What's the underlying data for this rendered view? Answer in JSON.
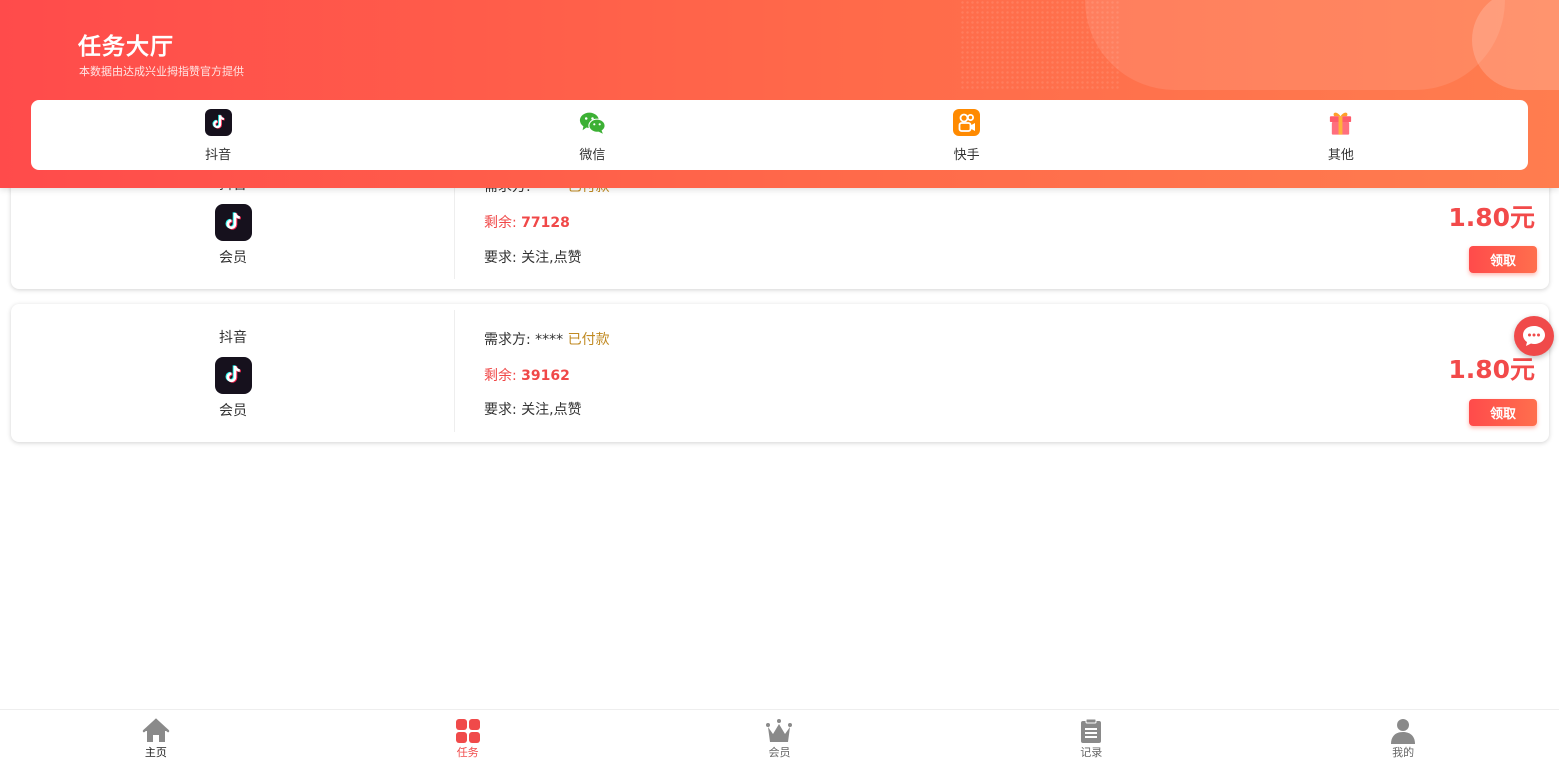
{
  "header": {
    "title": "任务大厅",
    "subtitle": "本数据由达成兴业拇指赞官方提供"
  },
  "categories": [
    {
      "label": "抖音",
      "icon": "douyin-icon"
    },
    {
      "label": "微信",
      "icon": "wechat-icon"
    },
    {
      "label": "快手",
      "icon": "kuaishou-icon"
    },
    {
      "label": "其他",
      "icon": "gift-icon"
    }
  ],
  "tasks": [
    {
      "platform": "抖音",
      "member": "会员",
      "demander_label": "需求方:",
      "demander": "****",
      "status": "已付款",
      "remain_label": "剩余:",
      "remain": "77128",
      "require_label": "要求:",
      "require": "关注,点赞",
      "price": "1.80元",
      "claim_label": "领取"
    },
    {
      "platform": "抖音",
      "member": "会员",
      "demander_label": "需求方:",
      "demander": "****",
      "status": "已付款",
      "remain_label": "剩余:",
      "remain": "39162",
      "require_label": "要求:",
      "require": "关注,点赞",
      "price": "1.80元",
      "claim_label": "领取"
    }
  ],
  "bottom_nav": [
    {
      "label": "主页",
      "icon": "home-icon"
    },
    {
      "label": "任务",
      "icon": "grid-icon",
      "active": true
    },
    {
      "label": "会员",
      "icon": "crown-icon"
    },
    {
      "label": "记录",
      "icon": "clipboard-icon"
    },
    {
      "label": "我的",
      "icon": "user-icon"
    }
  ],
  "colors": {
    "accent": "#f04a4a",
    "header_start": "#ff4b4b",
    "header_end": "#ff7d4f",
    "paid": "#c08a22"
  }
}
